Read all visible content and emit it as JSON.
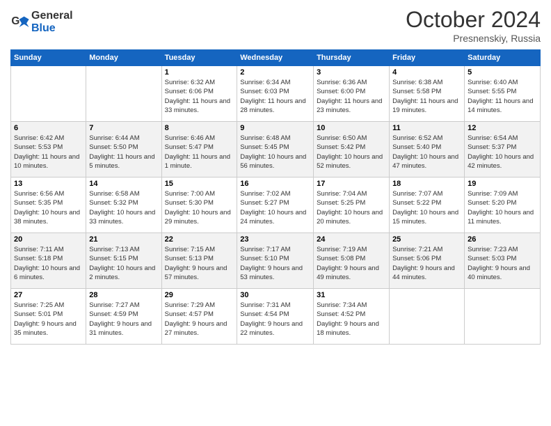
{
  "header": {
    "logo_line1": "General",
    "logo_line2": "Blue",
    "month": "October 2024",
    "location": "Presnenskiy, Russia"
  },
  "days_of_week": [
    "Sunday",
    "Monday",
    "Tuesday",
    "Wednesday",
    "Thursday",
    "Friday",
    "Saturday"
  ],
  "weeks": [
    [
      {
        "day": "",
        "info": ""
      },
      {
        "day": "",
        "info": ""
      },
      {
        "day": "1",
        "info": "Sunrise: 6:32 AM\nSunset: 6:06 PM\nDaylight: 11 hours and 33 minutes."
      },
      {
        "day": "2",
        "info": "Sunrise: 6:34 AM\nSunset: 6:03 PM\nDaylight: 11 hours and 28 minutes."
      },
      {
        "day": "3",
        "info": "Sunrise: 6:36 AM\nSunset: 6:00 PM\nDaylight: 11 hours and 23 minutes."
      },
      {
        "day": "4",
        "info": "Sunrise: 6:38 AM\nSunset: 5:58 PM\nDaylight: 11 hours and 19 minutes."
      },
      {
        "day": "5",
        "info": "Sunrise: 6:40 AM\nSunset: 5:55 PM\nDaylight: 11 hours and 14 minutes."
      }
    ],
    [
      {
        "day": "6",
        "info": "Sunrise: 6:42 AM\nSunset: 5:53 PM\nDaylight: 11 hours and 10 minutes."
      },
      {
        "day": "7",
        "info": "Sunrise: 6:44 AM\nSunset: 5:50 PM\nDaylight: 11 hours and 5 minutes."
      },
      {
        "day": "8",
        "info": "Sunrise: 6:46 AM\nSunset: 5:47 PM\nDaylight: 11 hours and 1 minute."
      },
      {
        "day": "9",
        "info": "Sunrise: 6:48 AM\nSunset: 5:45 PM\nDaylight: 10 hours and 56 minutes."
      },
      {
        "day": "10",
        "info": "Sunrise: 6:50 AM\nSunset: 5:42 PM\nDaylight: 10 hours and 52 minutes."
      },
      {
        "day": "11",
        "info": "Sunrise: 6:52 AM\nSunset: 5:40 PM\nDaylight: 10 hours and 47 minutes."
      },
      {
        "day": "12",
        "info": "Sunrise: 6:54 AM\nSunset: 5:37 PM\nDaylight: 10 hours and 42 minutes."
      }
    ],
    [
      {
        "day": "13",
        "info": "Sunrise: 6:56 AM\nSunset: 5:35 PM\nDaylight: 10 hours and 38 minutes."
      },
      {
        "day": "14",
        "info": "Sunrise: 6:58 AM\nSunset: 5:32 PM\nDaylight: 10 hours and 33 minutes."
      },
      {
        "day": "15",
        "info": "Sunrise: 7:00 AM\nSunset: 5:30 PM\nDaylight: 10 hours and 29 minutes."
      },
      {
        "day": "16",
        "info": "Sunrise: 7:02 AM\nSunset: 5:27 PM\nDaylight: 10 hours and 24 minutes."
      },
      {
        "day": "17",
        "info": "Sunrise: 7:04 AM\nSunset: 5:25 PM\nDaylight: 10 hours and 20 minutes."
      },
      {
        "day": "18",
        "info": "Sunrise: 7:07 AM\nSunset: 5:22 PM\nDaylight: 10 hours and 15 minutes."
      },
      {
        "day": "19",
        "info": "Sunrise: 7:09 AM\nSunset: 5:20 PM\nDaylight: 10 hours and 11 minutes."
      }
    ],
    [
      {
        "day": "20",
        "info": "Sunrise: 7:11 AM\nSunset: 5:18 PM\nDaylight: 10 hours and 6 minutes."
      },
      {
        "day": "21",
        "info": "Sunrise: 7:13 AM\nSunset: 5:15 PM\nDaylight: 10 hours and 2 minutes."
      },
      {
        "day": "22",
        "info": "Sunrise: 7:15 AM\nSunset: 5:13 PM\nDaylight: 9 hours and 57 minutes."
      },
      {
        "day": "23",
        "info": "Sunrise: 7:17 AM\nSunset: 5:10 PM\nDaylight: 9 hours and 53 minutes."
      },
      {
        "day": "24",
        "info": "Sunrise: 7:19 AM\nSunset: 5:08 PM\nDaylight: 9 hours and 49 minutes."
      },
      {
        "day": "25",
        "info": "Sunrise: 7:21 AM\nSunset: 5:06 PM\nDaylight: 9 hours and 44 minutes."
      },
      {
        "day": "26",
        "info": "Sunrise: 7:23 AM\nSunset: 5:03 PM\nDaylight: 9 hours and 40 minutes."
      }
    ],
    [
      {
        "day": "27",
        "info": "Sunrise: 7:25 AM\nSunset: 5:01 PM\nDaylight: 9 hours and 35 minutes."
      },
      {
        "day": "28",
        "info": "Sunrise: 7:27 AM\nSunset: 4:59 PM\nDaylight: 9 hours and 31 minutes."
      },
      {
        "day": "29",
        "info": "Sunrise: 7:29 AM\nSunset: 4:57 PM\nDaylight: 9 hours and 27 minutes."
      },
      {
        "day": "30",
        "info": "Sunrise: 7:31 AM\nSunset: 4:54 PM\nDaylight: 9 hours and 22 minutes."
      },
      {
        "day": "31",
        "info": "Sunrise: 7:34 AM\nSunset: 4:52 PM\nDaylight: 9 hours and 18 minutes."
      },
      {
        "day": "",
        "info": ""
      },
      {
        "day": "",
        "info": ""
      }
    ]
  ]
}
